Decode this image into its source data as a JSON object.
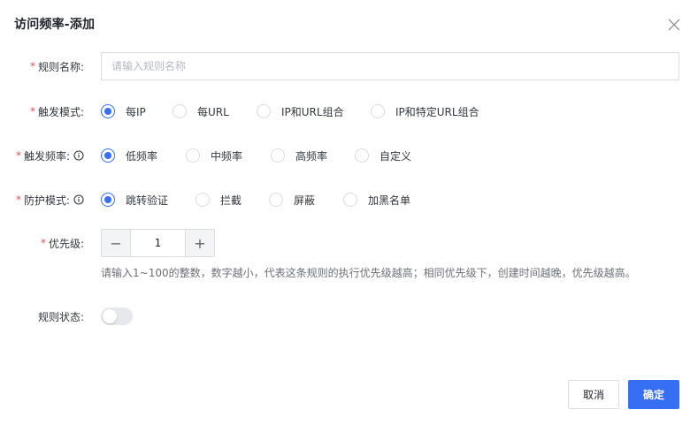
{
  "dialog": {
    "title": "访问频率-添加"
  },
  "form": {
    "rule_name": {
      "label": "规则名称:",
      "required_mark": "*",
      "placeholder": "请输入规则名称",
      "value": ""
    },
    "trigger_mode": {
      "label": "触发模式:",
      "required_mark": "*",
      "options": [
        "每IP",
        "每URL",
        "IP和URL组合",
        "IP和特定URL组合"
      ],
      "selected": "每IP"
    },
    "trigger_frequency": {
      "label": "触发频率:",
      "required_mark": "*",
      "has_info_icon": true,
      "options": [
        "低频率",
        "中频率",
        "高频率",
        "自定义"
      ],
      "selected": "低频率"
    },
    "protection_mode": {
      "label": "防护模式:",
      "required_mark": "*",
      "has_info_icon": true,
      "options": [
        "跳转验证",
        "拦截",
        "屏蔽",
        "加黑名单"
      ],
      "selected": "跳转验证"
    },
    "priority": {
      "label": "优先级:",
      "required_mark": "*",
      "value": "1",
      "minus": "−",
      "plus": "+",
      "hint": "请输入1~100的整数，数字越小，代表这条规则的执行优先级越高；相同优先级下，创建时间越晚，优先级越高。"
    },
    "rule_status": {
      "label": "规则状态:",
      "enabled": false
    }
  },
  "footer": {
    "cancel_label": "取消",
    "confirm_label": "确定"
  },
  "colors": {
    "primary": "#366ef4",
    "required": "#e34d59",
    "border": "#dcdcdc"
  },
  "icons": {
    "close": "close-icon",
    "info": "info-circle-icon"
  }
}
